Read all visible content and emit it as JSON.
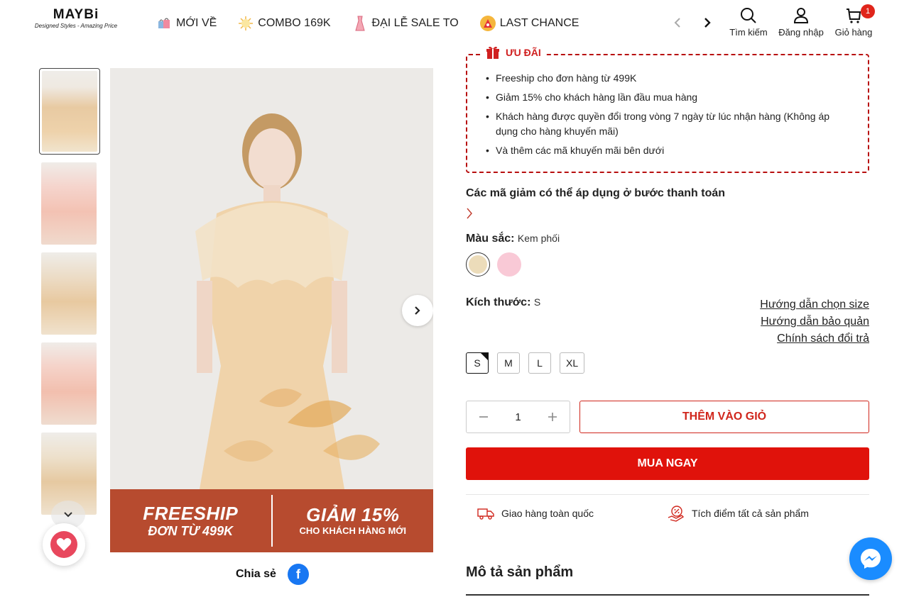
{
  "header": {
    "logo": {
      "brand": "MAYBi",
      "tagline": "Designed Styles - Amazing Price"
    },
    "nav": [
      {
        "label": "MỚI VỀ",
        "icon": "shopping-bags-icon"
      },
      {
        "label": "COMBO 169K",
        "icon": "sparkle-icon"
      },
      {
        "label": "ĐẠI LỄ SALE TO",
        "icon": "dress-icon"
      },
      {
        "label": "LAST CHANCE",
        "icon": "clock-icon"
      }
    ],
    "actions": {
      "search": "Tìm kiếm",
      "login": "Đăng nhập",
      "cart": "Giỏ hàng",
      "cart_count": "1"
    }
  },
  "gallery": {
    "thumbnails_count": 5,
    "banner": {
      "left_big": "FREESHIP",
      "left_small": "ĐƠN TỪ 499K",
      "right_big": "GIẢM 15%",
      "right_small": "CHO KHÁCH HÀNG MỚI"
    },
    "share_label": "Chia sẻ"
  },
  "offer": {
    "title": "ƯU ĐÃI",
    "items": [
      "Freeship cho đơn hàng từ 499K",
      "Giảm 15% cho khách hàng lần đầu mua hàng",
      "Khách hàng được quyền đổi trong vòng 7 ngày từ lúc nhận hàng (Không áp dụng cho hàng khuyến mãi)",
      "Và thêm các mã khuyến mãi bên dưới"
    ]
  },
  "coupons": {
    "title": "Các mã giảm có thể áp dụng ở bước thanh toán"
  },
  "color": {
    "label": "Màu sắc:",
    "value": "Kem phối",
    "swatches": [
      "#ecdcba",
      "#f9c9d6"
    ]
  },
  "size": {
    "label": "Kích thước:",
    "value": "S",
    "options": [
      "S",
      "M",
      "L",
      "XL"
    ],
    "guides": [
      "Hướng dẫn chọn size",
      "Hướng dẫn bảo quản",
      "Chính sách đổi trả"
    ]
  },
  "purchase": {
    "quantity": "1",
    "add_to_cart": "THÊM VÀO GIỎ",
    "buy_now": "MUA NGAY"
  },
  "perks": [
    "Giao hàng toàn quốc",
    "Tích điểm tất cả sản phẩm"
  ],
  "description": {
    "title": "Mô tả sản phẩm"
  },
  "colors": {
    "accent_red": "#e0120b",
    "offer_border": "#b80f0f",
    "banner_bg": "#b74b2f",
    "messenger": "#1a8cff"
  }
}
